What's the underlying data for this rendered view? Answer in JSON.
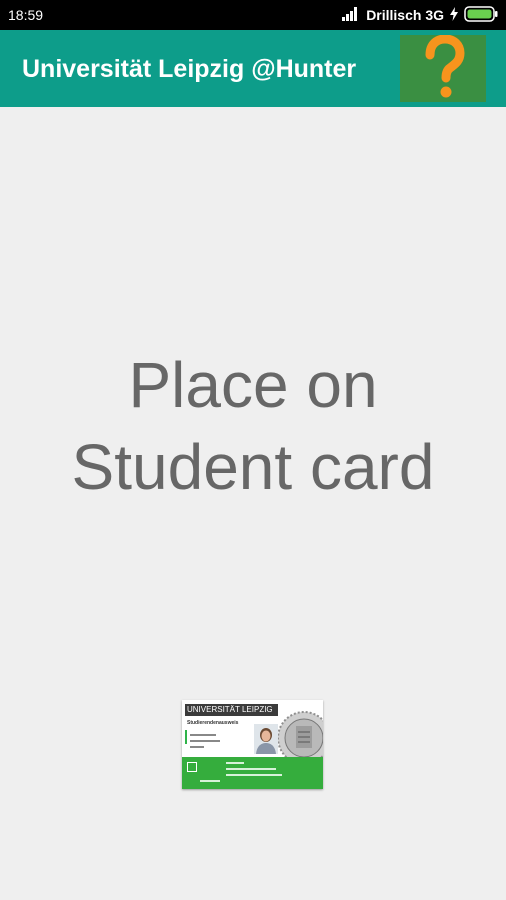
{
  "status_bar": {
    "time": "18:59",
    "carrier": "Drillisch 3G",
    "icons": [
      "signal-icon",
      "charging-bolt-icon",
      "battery-icon"
    ]
  },
  "app_bar": {
    "title": "Universität Leipzig @Hunter",
    "help_icon": "question-mark-icon",
    "colors": {
      "background": "#0d9d8a",
      "help_button_background": "#3a8f42",
      "question_mark": "#f7941d"
    }
  },
  "main": {
    "instruction_line1": "Place on",
    "instruction_line2": "Student card"
  },
  "student_card": {
    "header_text": "UNIVERSITÄT LEIPZIG",
    "subtitle": "Studierendenausweis",
    "accent_color": "#35ad3d"
  }
}
